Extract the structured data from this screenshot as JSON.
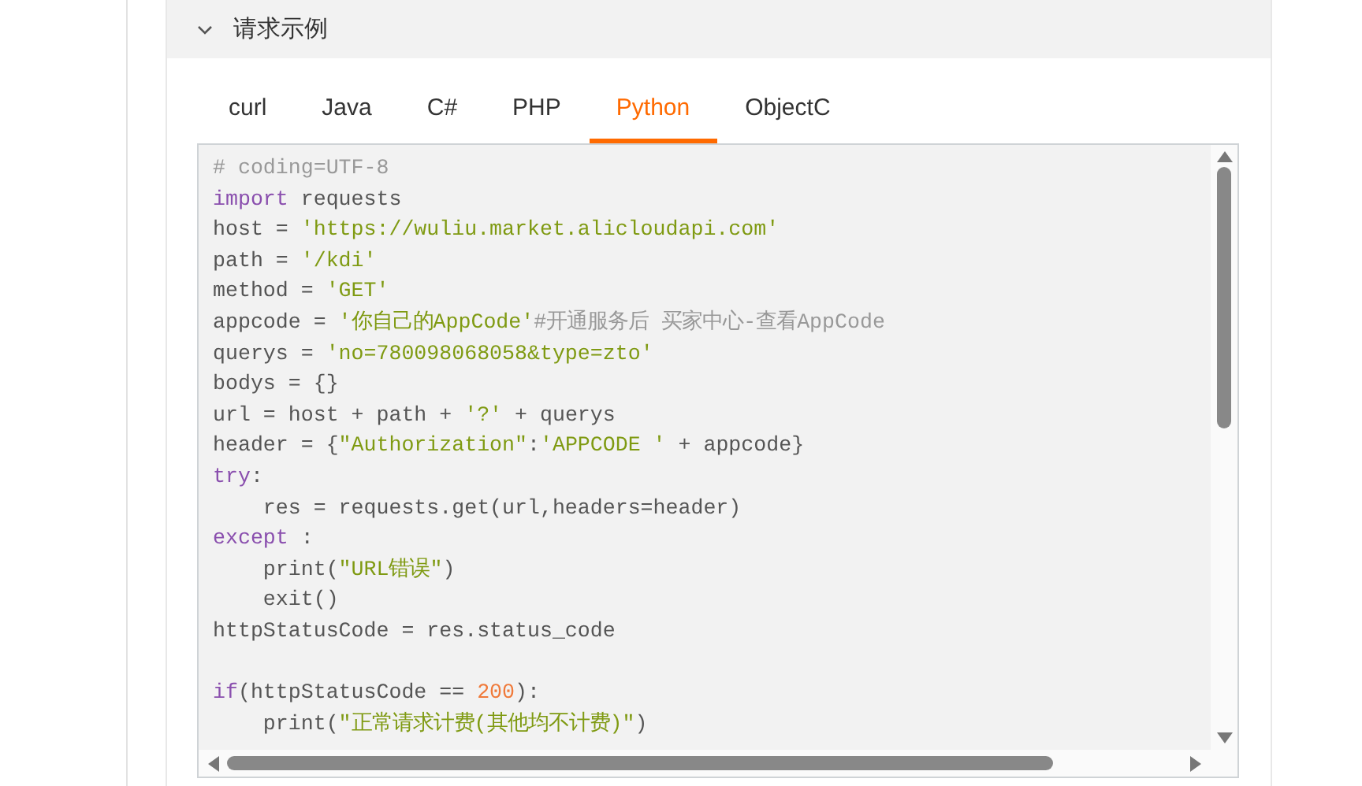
{
  "section": {
    "title": "请求示例",
    "expanded": true
  },
  "tabs": [
    {
      "label": "curl",
      "selected": false
    },
    {
      "label": "Java",
      "selected": false
    },
    {
      "label": "C#",
      "selected": false
    },
    {
      "label": "PHP",
      "selected": false
    },
    {
      "label": "Python",
      "selected": true
    },
    {
      "label": "ObjectC",
      "selected": false
    }
  ],
  "code_lines": [
    {
      "kind": "code",
      "tokens": [
        {
          "kind": "comment",
          "text": "# coding=UTF-8"
        }
      ]
    },
    {
      "kind": "code",
      "tokens": [
        {
          "kind": "keyword",
          "text": "import"
        },
        {
          "kind": "plain",
          "text": " requests"
        }
      ]
    },
    {
      "kind": "code",
      "tokens": [
        {
          "kind": "plain",
          "text": "host = "
        },
        {
          "kind": "string",
          "text": "'https://wuliu.market.alicloudapi.com'"
        }
      ]
    },
    {
      "kind": "code",
      "tokens": [
        {
          "kind": "plain",
          "text": "path = "
        },
        {
          "kind": "string",
          "text": "'/kdi'"
        }
      ]
    },
    {
      "kind": "code",
      "tokens": [
        {
          "kind": "plain",
          "text": "method = "
        },
        {
          "kind": "string",
          "text": "'GET'"
        }
      ]
    },
    {
      "kind": "code",
      "tokens": [
        {
          "kind": "plain",
          "text": "appcode = "
        },
        {
          "kind": "string",
          "text": "'你自己的AppCode'"
        },
        {
          "kind": "comment",
          "text": "#开通服务后 买家中心-查看AppCode"
        }
      ]
    },
    {
      "kind": "code",
      "tokens": [
        {
          "kind": "plain",
          "text": "querys = "
        },
        {
          "kind": "string",
          "text": "'no=780098068058&type=zto'"
        }
      ]
    },
    {
      "kind": "code",
      "tokens": [
        {
          "kind": "plain",
          "text": "bodys = {}"
        }
      ]
    },
    {
      "kind": "code",
      "tokens": [
        {
          "kind": "plain",
          "text": "url = host + path + "
        },
        {
          "kind": "string",
          "text": "'?'"
        },
        {
          "kind": "plain",
          "text": " + querys"
        }
      ]
    },
    {
      "kind": "code",
      "tokens": [
        {
          "kind": "plain",
          "text": "header = {"
        },
        {
          "kind": "string",
          "text": "\"Authorization\""
        },
        {
          "kind": "plain",
          "text": ":"
        },
        {
          "kind": "string",
          "text": "'APPCODE '"
        },
        {
          "kind": "plain",
          "text": " + appcode}"
        }
      ]
    },
    {
      "kind": "code",
      "tokens": [
        {
          "kind": "keyword",
          "text": "try"
        },
        {
          "kind": "plain",
          "text": ":"
        }
      ]
    },
    {
      "kind": "code",
      "tokens": [
        {
          "kind": "plain",
          "text": "    res = requests.get(url,headers=header)"
        }
      ]
    },
    {
      "kind": "code",
      "tokens": [
        {
          "kind": "keyword",
          "text": "except"
        },
        {
          "kind": "plain",
          "text": " :"
        }
      ]
    },
    {
      "kind": "code",
      "tokens": [
        {
          "kind": "plain",
          "text": "    print("
        },
        {
          "kind": "string",
          "text": "\"URL错误\""
        },
        {
          "kind": "plain",
          "text": ")"
        }
      ]
    },
    {
      "kind": "code",
      "tokens": [
        {
          "kind": "plain",
          "text": "    exit()"
        }
      ]
    },
    {
      "kind": "code",
      "tokens": [
        {
          "kind": "plain",
          "text": "httpStatusCode = res.status_code"
        }
      ]
    },
    {
      "kind": "blank"
    },
    {
      "kind": "code",
      "tokens": [
        {
          "kind": "keyword",
          "text": "if"
        },
        {
          "kind": "plain",
          "text": "(httpStatusCode == "
        },
        {
          "kind": "number",
          "text": "200"
        },
        {
          "kind": "plain",
          "text": "):"
        }
      ]
    },
    {
      "kind": "code",
      "tokens": [
        {
          "kind": "plain",
          "text": "    print("
        },
        {
          "kind": "string",
          "text": "\"正常请求计费(其他均不计费)\""
        },
        {
          "kind": "plain",
          "text": ")"
        }
      ]
    }
  ]
}
